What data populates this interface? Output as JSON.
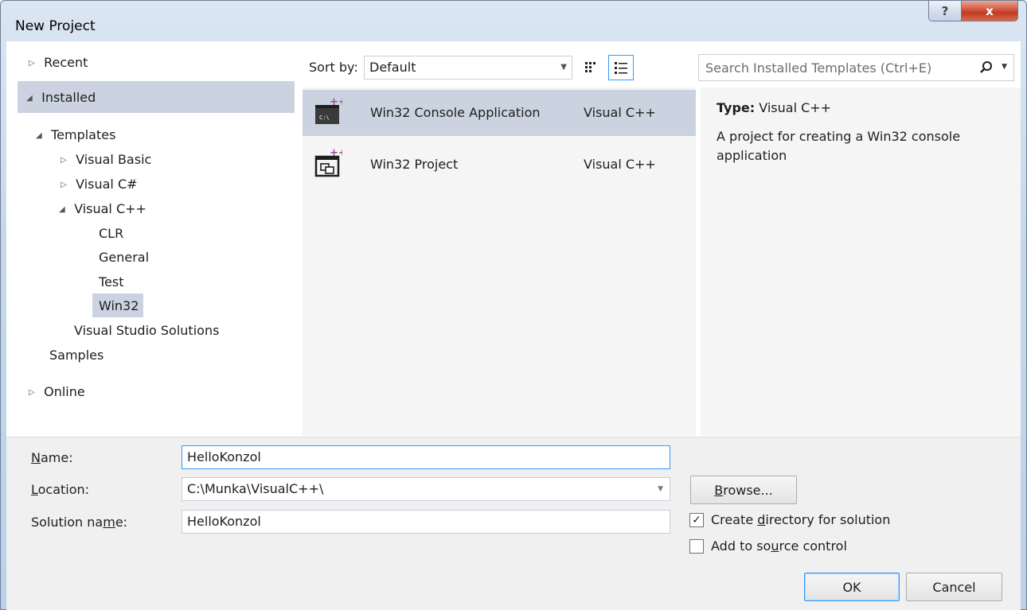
{
  "window": {
    "title": "New Project",
    "help_label": "?",
    "close_label": "x"
  },
  "tree": {
    "recent": "Recent",
    "installed": "Installed",
    "templates": "Templates",
    "visual_basic": "Visual Basic",
    "visual_csharp": "Visual C#",
    "visual_cpp": "Visual C++",
    "clr": "CLR",
    "general": "General",
    "test": "Test",
    "win32": "Win32",
    "vs_solutions": "Visual Studio Solutions",
    "samples": "Samples",
    "online": "Online"
  },
  "sort": {
    "label": "Sort by:",
    "value": "Default"
  },
  "search": {
    "placeholder": "Search Installed Templates (Ctrl+E)"
  },
  "templates": [
    {
      "name": "Win32 Console Application",
      "lang": "Visual C++",
      "icon": "console-app-icon",
      "selected": true
    },
    {
      "name": "Win32 Project",
      "lang": "Visual C++",
      "icon": "win32-project-icon",
      "selected": false
    }
  ],
  "details": {
    "type_label": "Type:",
    "type_value": "Visual C++",
    "description": "A project for creating a Win32 console application"
  },
  "form": {
    "name_label_pre": "",
    "name_label_u": "N",
    "name_label_post": "ame:",
    "name_value": "HelloKonzol",
    "location_label_u": "L",
    "location_label_post": "ocation:",
    "location_value": "C:\\Munka\\VisualC++\\",
    "solution_label_pre": "Solution na",
    "solution_label_u": "m",
    "solution_label_post": "e:",
    "solution_value": "HelloKonzol",
    "browse_u": "B",
    "browse_post": "rowse...",
    "create_dir_pre": "Create ",
    "create_dir_u": "d",
    "create_dir_post": "irectory for solution",
    "create_dir_checked": "✓",
    "source_pre": "Add to so",
    "source_u": "u",
    "source_post": "rce control",
    "ok_label": "OK",
    "cancel_label": "Cancel"
  },
  "colors": {
    "selection": "#cbd3e0",
    "accent": "#3399ff",
    "cpp_badge": "#9b4f96"
  }
}
